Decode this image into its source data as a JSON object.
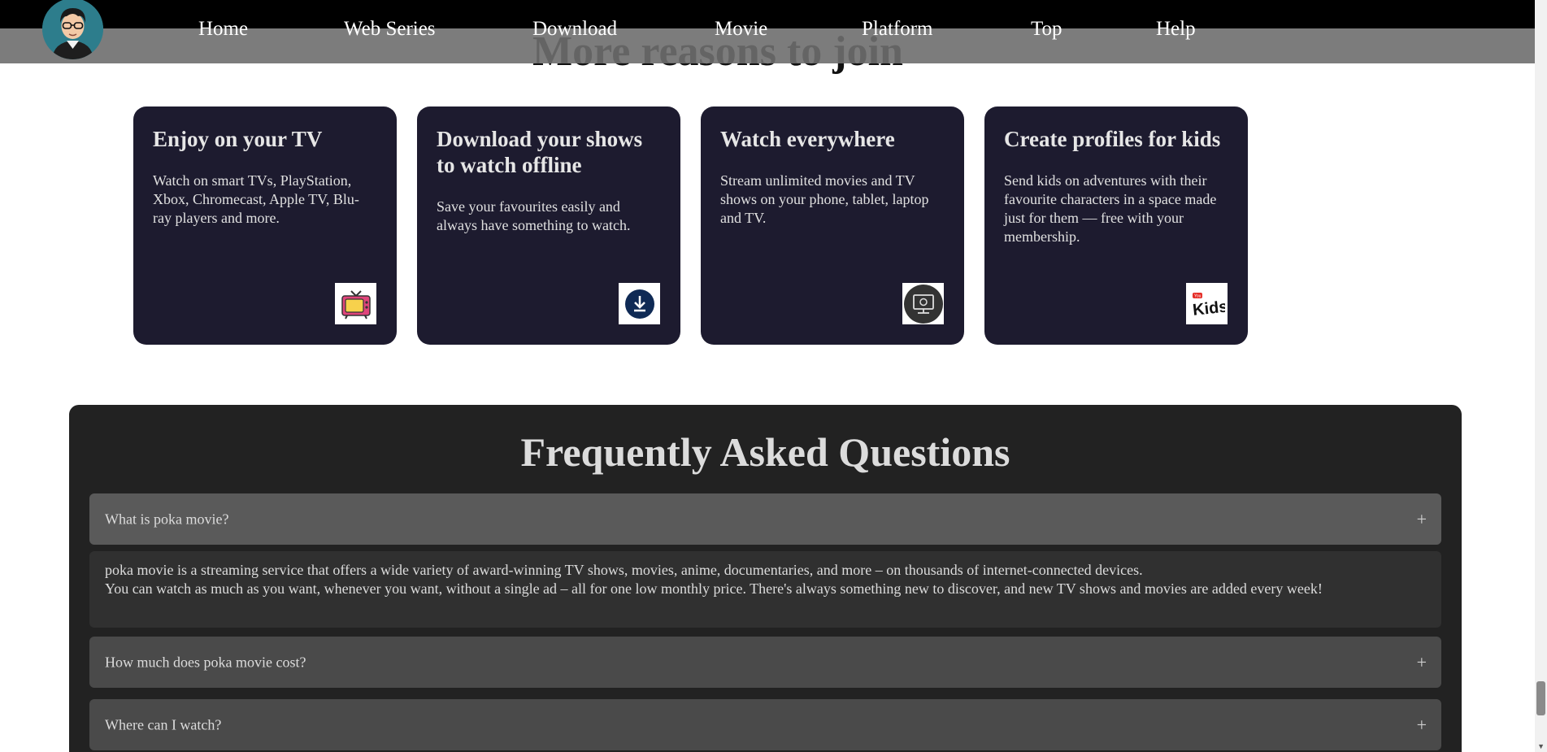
{
  "nav": {
    "links": [
      "Home",
      "Web Series",
      "Download",
      "Movie",
      "Platform",
      "Top",
      "Help"
    ]
  },
  "section": {
    "title": "More reasons to join"
  },
  "cards": [
    {
      "title": "Enjoy on your TV",
      "text": "Watch on smart TVs, PlayStation, Xbox, Chromecast, Apple TV, Blu-ray players and more.",
      "icon": "tv-icon"
    },
    {
      "title": "Download your shows to watch offline",
      "text": "Save your favourites easily and always have something to watch.",
      "icon": "download-icon"
    },
    {
      "title": "Watch everywhere",
      "text": "Stream unlimited movies and TV shows on your phone, tablet, laptop and TV.",
      "icon": "monitor-icon"
    },
    {
      "title": "Create profiles for kids",
      "text": "Send kids on adventures with their favourite characters in a space made just for them — free with your membership.",
      "icon": "kids-icon"
    }
  ],
  "faq": {
    "title": "Frequently Asked Questions",
    "items": [
      {
        "question": "What is poka movie?"
      },
      {
        "question": "How much does poka movie cost?"
      },
      {
        "question": "Where can I watch?"
      }
    ],
    "answer_line1": "poka movie is a streaming service that offers a wide variety of award-winning TV shows, movies, anime, documentaries, and more – on thousands of internet-connected devices.",
    "answer_line2": "You can watch as much as you want, whenever you want, without a single ad – all for one low monthly price. There's always something new to discover, and new TV shows and movies are added every week!",
    "plus": "+"
  },
  "colors": {
    "card_bg": "#1d1b2f",
    "faq_bg": "#222222",
    "faq_item_bg": "#4a4a4a"
  }
}
